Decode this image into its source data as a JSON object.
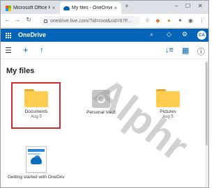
{
  "browser": {
    "tabs": [
      {
        "label": "Microsoft Office Ho",
        "close": "×"
      },
      {
        "label": "My files - OneDrive",
        "close": "×"
      }
    ],
    "new_tab": "+",
    "window_controls": {
      "minimize": "–",
      "maximize": "☐",
      "close": "✕"
    },
    "url": "onedrive.live.com/?id=root&cid=67F..."
  },
  "onedrive": {
    "title": "OneDrive",
    "avatar_initials": "CA",
    "brand_color": "#0364b8"
  },
  "page": {
    "title": "My files"
  },
  "items": [
    {
      "name": "Documents",
      "date": "Aug 5",
      "icon": "folder-icon",
      "selected": true
    },
    {
      "name": "Personal Vault",
      "date": "",
      "icon": "vault-icon",
      "selected": false
    },
    {
      "name": "Pictures",
      "date": "Aug 5",
      "icon": "folder-icon",
      "selected": false
    },
    {
      "name": "Getting started with OneDrive...",
      "date": "",
      "icon": "pdf-thumbnail-icon",
      "selected": false
    }
  ],
  "watermark": "Alphr"
}
